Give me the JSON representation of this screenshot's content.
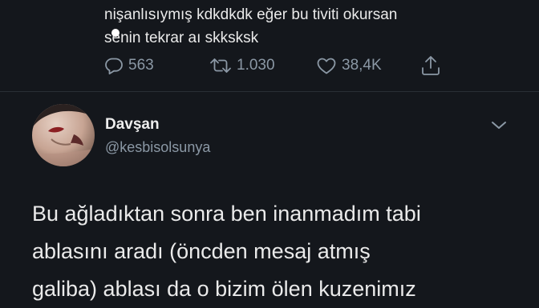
{
  "previous_tweet": {
    "lines": [
      "nişanlısıymış kdkdkdk eğer bu tiviti okursan",
      "senin tekrar aı skksksk"
    ],
    "actions": {
      "reply_icon": "reply-bubble-icon",
      "reply_count": "563",
      "retweet_icon": "retweet-icon",
      "retweet_count": "1.030",
      "like_icon": "heart-icon",
      "like_count": "38,4K",
      "share_icon": "share-icon"
    }
  },
  "reply_tweet": {
    "display_name": "Davşan",
    "handle": "@kesbisolsunya",
    "menu_icon": "chevron-down-icon",
    "body_lines": [
      "Bu ağladıktan sonra ben inanmadım tabi",
      "ablasını aradı (öncden mesaj atmış",
      "galiba) ablası da o bizim ölen kuzenimız"
    ]
  },
  "colors": {
    "background": "#14171c",
    "text": "#eaeaea",
    "muted": "#8b98a5",
    "divider": "#2a2f36"
  }
}
